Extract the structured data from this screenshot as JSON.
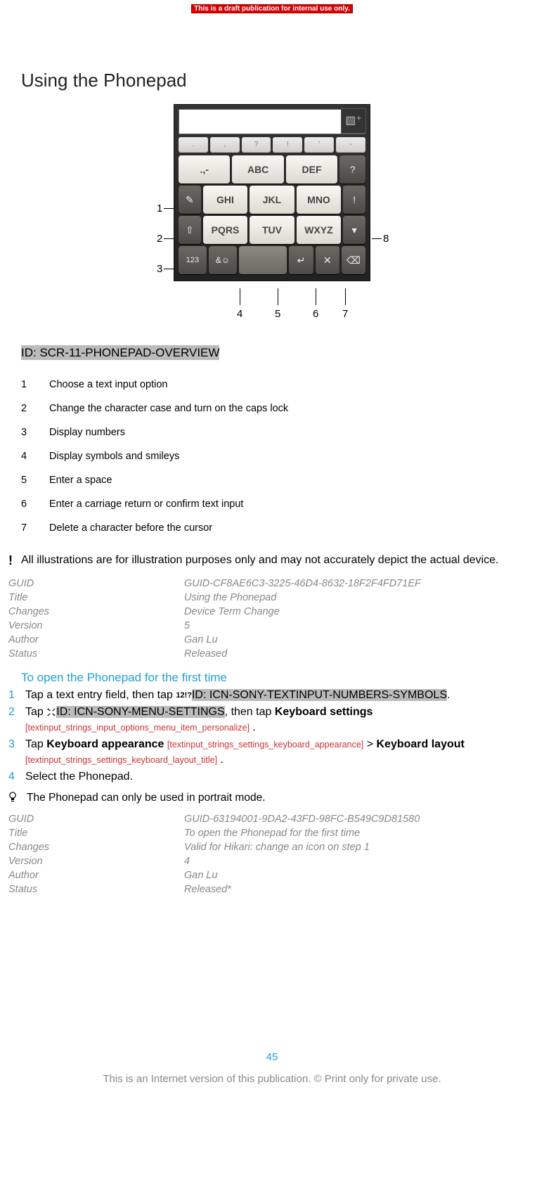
{
  "banner": "This is a draft publication for internal use only.",
  "title": "Using the Phonepad",
  "phonepad": {
    "hints": [
      ".",
      ",",
      "?",
      "!",
      "'",
      "-"
    ],
    "rows": [
      [
        ".,-",
        "ABC",
        "DEF",
        "?"
      ],
      [
        "GHI",
        "JKL",
        "MNO",
        "!"
      ],
      [
        "PQRS",
        "TUV",
        "WXYZ",
        ""
      ],
      [
        "123",
        "&☺",
        "",
        "↵",
        "✕",
        "⌫"
      ]
    ],
    "left_callouts": [
      "1",
      "2",
      "3"
    ],
    "bottom_callouts": [
      "4",
      "5",
      "6",
      "7"
    ],
    "right_callout": "8"
  },
  "asset_id": "ID: SCR-11-PHONEPAD-OVERVIEW",
  "legend": [
    {
      "n": "1",
      "t": "Choose a text input option"
    },
    {
      "n": "2",
      "t": "Change the character case and turn on the caps lock"
    },
    {
      "n": "3",
      "t": "Display numbers"
    },
    {
      "n": "4",
      "t": "Display symbols and smileys"
    },
    {
      "n": "5",
      "t": "Enter a space"
    },
    {
      "n": "6",
      "t": "Enter a carriage return or confirm text input"
    },
    {
      "n": "7",
      "t": "Delete a character before the cursor"
    }
  ],
  "warn_symbol": "!",
  "warn_text": "All illustrations are for illustration purposes only and may not accurately depict the actual device.",
  "meta1": {
    "GUID": "GUID-CF8AE6C3-3225-46D4-8632-18F2F4FD71EF",
    "Title": "Using the Phonepad",
    "Changes": "Device Term Change",
    "Version": "5",
    "Author": "Gan Lu",
    "Status": "Released"
  },
  "subheading": "To open the Phonepad for the first time",
  "steps": {
    "s1_a": "Tap a text entry field, then tap ",
    "s1_icon": "12!?",
    "s1_b": "ID: ICN-SONY-TEXTINPUT-NUMBERS-SYMBOLS",
    "s1_c": ".",
    "s2_a": "Tap ",
    "s2_b": "ID: ICN-SONY-MENU-SETTINGS",
    "s2_c": ", then tap ",
    "s2_d": "Keyboard settings",
    "s2_ref": "[textinput_strings_input_options_menu_item_personalize]",
    "s2_e": " .",
    "s3_a": "Tap ",
    "s3_b": "Keyboard appearance",
    "s3_ref1": "[textinput_strings_settings_keyboard_appearance]",
    "s3_c": " > ",
    "s3_d": "Keyboard layout",
    "s3_ref2": "[textinput_strings_settings_keyboard_layout_title]",
    "s3_e": " .",
    "s4": "Select the Phonepad."
  },
  "tip": "The Phonepad can only be used in portrait mode.",
  "meta2": {
    "GUID": "GUID-63194001-9DA2-43FD-98FC-B549C9D81580",
    "Title": "To open the Phonepad for the first time",
    "Changes": "Valid for Hikari: change an icon on step 1",
    "Version": "4",
    "Author": "Gan Lu",
    "Status": "Released*"
  },
  "page_number": "45",
  "footer_note": "This is an Internet version of this publication. © Print only for private use."
}
